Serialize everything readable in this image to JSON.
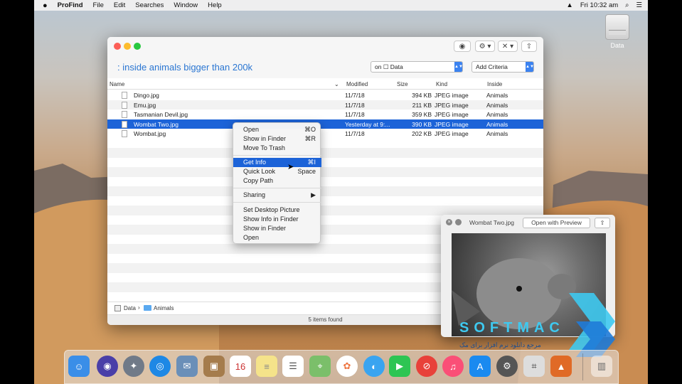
{
  "menubar": {
    "app_name": "ProFind",
    "items": [
      "File",
      "Edit",
      "Searches",
      "Window",
      "Help"
    ],
    "clock": "Fri 10:32 am"
  },
  "desktop": {
    "drive_label": "Data"
  },
  "window": {
    "query": ": inside animals bigger than 200k",
    "scope_select": "on ☐ Data",
    "add_criteria": "Add Criteria",
    "columns": {
      "name": "Name",
      "modified": "Modified",
      "size": "Size",
      "kind": "Kind",
      "inside": "Inside"
    },
    "rows": [
      {
        "name": "Dingo.jpg",
        "modified": "11/7/18",
        "size": "394 KB",
        "kind": "JPEG image",
        "inside": "Animals"
      },
      {
        "name": "Emu.jpg",
        "modified": "11/7/18",
        "size": "211 KB",
        "kind": "JPEG image",
        "inside": "Animals"
      },
      {
        "name": "Tasmanian Devil.jpg",
        "modified": "11/7/18",
        "size": "359 KB",
        "kind": "JPEG image",
        "inside": "Animals"
      },
      {
        "name": "Wombat Two.jpg",
        "modified": "Yesterday at 9:...",
        "size": "390 KB",
        "kind": "JPEG image",
        "inside": "Animals"
      },
      {
        "name": "Wombat.jpg",
        "modified": "11/7/18",
        "size": "202 KB",
        "kind": "JPEG image",
        "inside": "Animals"
      }
    ],
    "path": {
      "root": "Data",
      "folder": "Animals"
    },
    "status": "5 items found"
  },
  "context_menu": {
    "open": "Open",
    "open_sc": "⌘O",
    "show_in_finder": "Show in Finder",
    "show_in_finder_sc": "⌘R",
    "move_to_trash": "Move To Trash",
    "get_info": "Get Info",
    "get_info_sc": "⌘I",
    "quick_look": "Quick Look",
    "quick_look_sc": "Space",
    "copy_path": "Copy Path",
    "sharing": "Sharing",
    "set_desktop": "Set Desktop Picture",
    "show_info_finder": "Show Info in Finder",
    "show_in_finder2": "Show in Finder",
    "open2": "Open"
  },
  "quicklook": {
    "filename": "Wombat Two.jpg",
    "open_with": "Open with Preview"
  },
  "watermark": {
    "brand": "SOFTMAC",
    "tagline": "مرجع دانلود نرم افزار برای مک"
  },
  "colors": {
    "accent": "#1c63d8",
    "query": "#2a76d2"
  }
}
